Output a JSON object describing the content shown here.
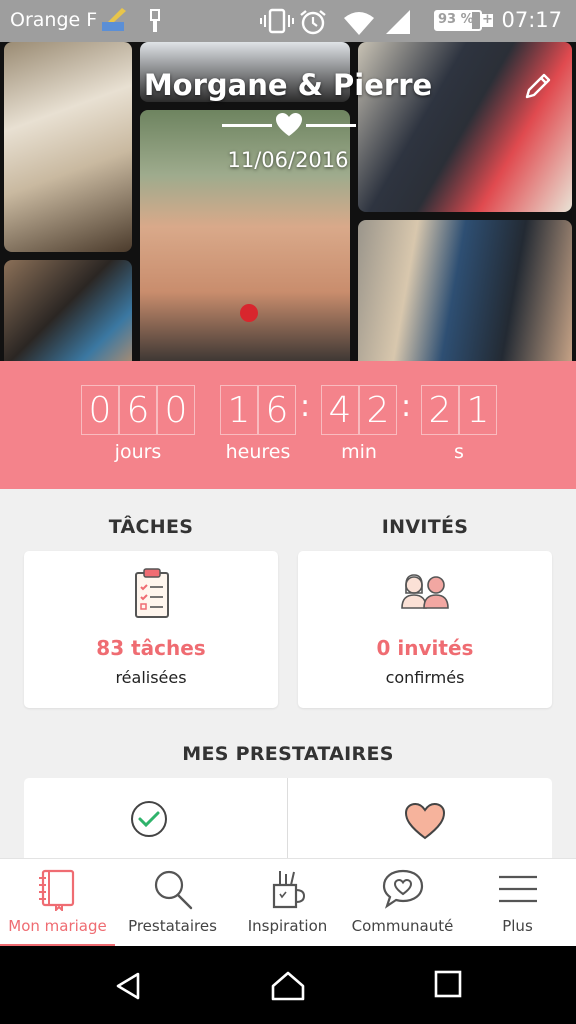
{
  "status_bar": {
    "carrier": "Orange F",
    "battery": "93 %",
    "time": "07:17"
  },
  "header": {
    "couple": "Morgane & Pierre",
    "date": "11/06/2016"
  },
  "countdown": {
    "days": [
      "0",
      "6",
      "0"
    ],
    "hours": [
      "1",
      "6"
    ],
    "minutes": [
      "4",
      "2"
    ],
    "seconds": [
      "2",
      "1"
    ],
    "labels": {
      "days": "jours",
      "hours": "heures",
      "minutes": "min",
      "seconds": "s"
    }
  },
  "tasks": {
    "title": "TÂCHES",
    "count": "83 tâches",
    "sub": "réalisées"
  },
  "guests": {
    "title": "INVITÉS",
    "count": "0 invités",
    "sub": "confirmés"
  },
  "vendors": {
    "title": "MES PRESTATAIRES"
  },
  "bottom_nav": {
    "items": [
      {
        "label": "Mon mariage",
        "icon": "notebook-icon"
      },
      {
        "label": "Prestataires",
        "icon": "search-icon"
      },
      {
        "label": "Inspiration",
        "icon": "pencil-cup-icon"
      },
      {
        "label": "Communauté",
        "icon": "chat-heart-icon"
      },
      {
        "label": "Plus",
        "icon": "menu-icon"
      }
    ]
  },
  "colors": {
    "accent": "#f4838b",
    "accent_text": "#ef6c72"
  }
}
